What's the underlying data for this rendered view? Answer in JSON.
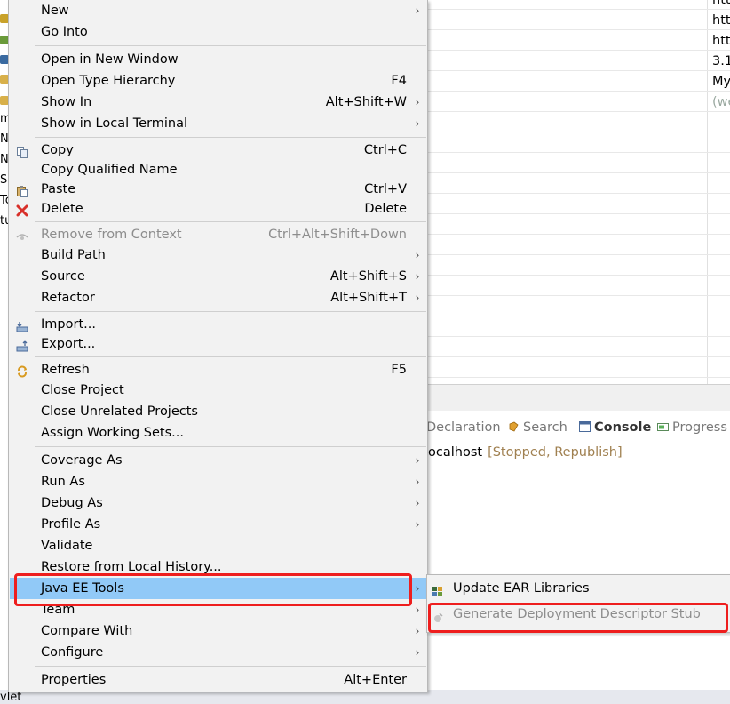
{
  "context_menu": {
    "items": [
      {
        "label": "New",
        "shortcut": "",
        "submenu": true,
        "icon": "",
        "disabled": false
      },
      {
        "label": "Go Into",
        "shortcut": "",
        "submenu": false,
        "icon": "",
        "disabled": false
      },
      {
        "label": "Open in New Window",
        "shortcut": "",
        "submenu": false,
        "icon": "",
        "disabled": false
      },
      {
        "label": "Open Type Hierarchy",
        "shortcut": "F4",
        "submenu": false,
        "icon": "",
        "disabled": false
      },
      {
        "label": "Show In",
        "shortcut": "Alt+Shift+W",
        "submenu": true,
        "icon": "",
        "disabled": false
      },
      {
        "label": "Show in Local Terminal",
        "shortcut": "",
        "submenu": true,
        "icon": "",
        "disabled": false
      },
      {
        "label": "Copy",
        "shortcut": "Ctrl+C",
        "submenu": false,
        "icon": "copy-icon",
        "disabled": false
      },
      {
        "label": "Copy Qualified Name",
        "shortcut": "",
        "submenu": false,
        "icon": "",
        "disabled": false
      },
      {
        "label": "Paste",
        "shortcut": "Ctrl+V",
        "submenu": false,
        "icon": "paste-icon",
        "disabled": false
      },
      {
        "label": "Delete",
        "shortcut": "Delete",
        "submenu": false,
        "icon": "delete-icon",
        "disabled": false
      },
      {
        "label": "Remove from Context",
        "shortcut": "Ctrl+Alt+Shift+Down",
        "submenu": false,
        "icon": "remove-context-icon",
        "disabled": true
      },
      {
        "label": "Build Path",
        "shortcut": "",
        "submenu": true,
        "icon": "",
        "disabled": false
      },
      {
        "label": "Source",
        "shortcut": "Alt+Shift+S",
        "submenu": true,
        "icon": "",
        "disabled": false
      },
      {
        "label": "Refactor",
        "shortcut": "Alt+Shift+T",
        "submenu": true,
        "icon": "",
        "disabled": false
      },
      {
        "label": "Import...",
        "shortcut": "",
        "submenu": false,
        "icon": "import-icon",
        "disabled": false
      },
      {
        "label": "Export...",
        "shortcut": "",
        "submenu": false,
        "icon": "export-icon",
        "disabled": false
      },
      {
        "label": "Refresh",
        "shortcut": "F5",
        "submenu": false,
        "icon": "refresh-icon",
        "disabled": false
      },
      {
        "label": "Close Project",
        "shortcut": "",
        "submenu": false,
        "icon": "",
        "disabled": false
      },
      {
        "label": "Close Unrelated Projects",
        "shortcut": "",
        "submenu": false,
        "icon": "",
        "disabled": false
      },
      {
        "label": "Assign Working Sets...",
        "shortcut": "",
        "submenu": false,
        "icon": "",
        "disabled": false
      },
      {
        "label": "Coverage As",
        "shortcut": "",
        "submenu": true,
        "icon": "",
        "disabled": false
      },
      {
        "label": "Run As",
        "shortcut": "",
        "submenu": true,
        "icon": "",
        "disabled": false
      },
      {
        "label": "Debug As",
        "shortcut": "",
        "submenu": true,
        "icon": "",
        "disabled": false
      },
      {
        "label": "Profile As",
        "shortcut": "",
        "submenu": true,
        "icon": "",
        "disabled": false
      },
      {
        "label": "Validate",
        "shortcut": "",
        "submenu": false,
        "icon": "",
        "disabled": false
      },
      {
        "label": "Restore from Local History...",
        "shortcut": "",
        "submenu": false,
        "icon": "",
        "disabled": false
      },
      {
        "label": "Java EE Tools",
        "shortcut": "",
        "submenu": true,
        "icon": "",
        "disabled": false,
        "highlighted": true
      },
      {
        "label": "Team",
        "shortcut": "",
        "submenu": true,
        "icon": "",
        "disabled": false
      },
      {
        "label": "Compare With",
        "shortcut": "",
        "submenu": true,
        "icon": "",
        "disabled": false
      },
      {
        "label": "Configure",
        "shortcut": "",
        "submenu": true,
        "icon": "",
        "disabled": false
      },
      {
        "label": "Properties",
        "shortcut": "Alt+Enter",
        "submenu": false,
        "icon": "",
        "disabled": false
      }
    ],
    "submenu_arrow": "›"
  },
  "submenu": {
    "items": [
      {
        "label": "Update EAR Libraries",
        "icon": "ear-libraries-icon",
        "disabled": false
      },
      {
        "label": "Generate Deployment Descriptor Stub",
        "icon": "descriptor-stub-icon",
        "disabled": true
      }
    ]
  },
  "background": {
    "left_fragments": [
      "m",
      "N",
      "N",
      "So",
      "To",
      "tu"
    ],
    "table_cells": [
      "htt",
      "htt",
      "htt",
      "3.1",
      "My",
      "(we"
    ],
    "console_tabs": [
      {
        "label": "Declaration",
        "icon": "declaration-icon"
      },
      {
        "label": "Search",
        "icon": "search-icon"
      },
      {
        "label": "Console",
        "icon": "console-icon"
      },
      {
        "label": "Progress",
        "icon": "progress-icon"
      }
    ],
    "server_name": "ocalhost",
    "server_status": "[Stopped, Republish]",
    "bottom_fragment": "vlet"
  },
  "colors": {
    "highlight": "#91c9f7",
    "annotation": "#ee1e1e",
    "menu_bg": "#f2f2f2"
  }
}
